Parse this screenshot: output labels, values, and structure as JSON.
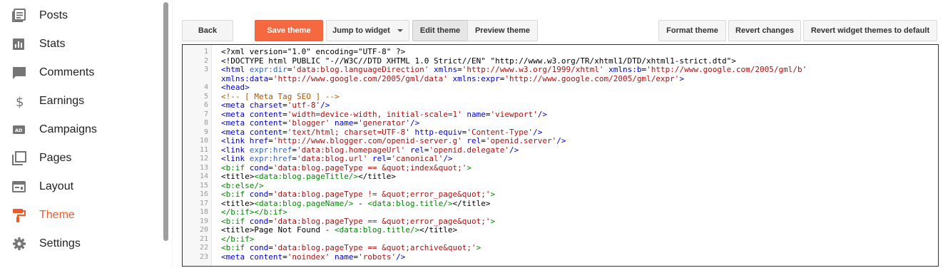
{
  "sidebar": {
    "items": [
      {
        "label": "Posts",
        "icon": "posts-icon"
      },
      {
        "label": "Stats",
        "icon": "stats-icon"
      },
      {
        "label": "Comments",
        "icon": "comments-icon"
      },
      {
        "label": "Earnings",
        "icon": "dollar-icon"
      },
      {
        "label": "Campaigns",
        "icon": "ad-icon"
      },
      {
        "label": "Pages",
        "icon": "pages-icon"
      },
      {
        "label": "Layout",
        "icon": "layout-icon"
      },
      {
        "label": "Theme",
        "icon": "paint-roller-icon",
        "active": true
      },
      {
        "label": "Settings",
        "icon": "gear-icon"
      }
    ],
    "accent": "#f05a28"
  },
  "toolbar": {
    "back": "Back",
    "save_theme": "Save theme",
    "jump_to_widget": "Jump to widget",
    "edit_theme": "Edit theme",
    "preview_theme": "Preview theme",
    "format_theme": "Format theme",
    "revert_changes": "Revert changes",
    "revert_widget_themes": "Revert widget themes to default"
  },
  "editor": {
    "lines": [
      {
        "n": "1",
        "segs": [
          [
            "p",
            "<?xml version=\"1.0\" encoding=\"UTF-8\" ?>"
          ]
        ]
      },
      {
        "n": "2",
        "segs": [
          [
            "p",
            "<!DOCTYPE html PUBLIC \"-//W3C//DTD XHTML 1.0 Strict//EN\" \"http://www.w3.org/TR/xhtml1/DTD/xhtml1-strict.dtd\">"
          ]
        ]
      },
      {
        "n": "3",
        "segs": [
          [
            "t",
            "<html "
          ],
          [
            "n",
            "expr:dir"
          ],
          [
            "p",
            "="
          ],
          [
            "s",
            "'data:blog.languageDirection'"
          ],
          [
            "p",
            " "
          ],
          [
            "a",
            "xmlns"
          ],
          [
            "p",
            "="
          ],
          [
            "s",
            "'http://www.w3.org/1999/xhtml'"
          ],
          [
            "p",
            " "
          ],
          [
            "a",
            "xmlns:b"
          ],
          [
            "p",
            "="
          ],
          [
            "s",
            "'http://www.google.com/2005/gml/b'"
          ]
        ]
      },
      {
        "n": "",
        "segs": [
          [
            "a",
            "xmlns:data"
          ],
          [
            "p",
            "="
          ],
          [
            "s",
            "'http://www.google.com/2005/gml/data'"
          ],
          [
            "p",
            " "
          ],
          [
            "a",
            "xmlns:expr"
          ],
          [
            "p",
            "="
          ],
          [
            "s",
            "'http://www.google.com/2005/gml/expr'"
          ],
          [
            "t",
            ">"
          ]
        ]
      },
      {
        "n": "4",
        "segs": [
          [
            "t",
            "<head>"
          ]
        ]
      },
      {
        "n": "5",
        "segs": [
          [
            "c",
            "<!-- [ Meta Tag SEO ] -->"
          ]
        ]
      },
      {
        "n": "6",
        "segs": [
          [
            "t",
            "<meta "
          ],
          [
            "a",
            "charset"
          ],
          [
            "p",
            "="
          ],
          [
            "s",
            "'utf-8'"
          ],
          [
            "t",
            "/>"
          ]
        ]
      },
      {
        "n": "7",
        "segs": [
          [
            "t",
            "<meta "
          ],
          [
            "a",
            "content"
          ],
          [
            "p",
            "="
          ],
          [
            "s",
            "'width=device-width, initial-scale=1'"
          ],
          [
            "p",
            " "
          ],
          [
            "a",
            "name"
          ],
          [
            "p",
            "="
          ],
          [
            "s",
            "'viewport'"
          ],
          [
            "t",
            "/>"
          ]
        ]
      },
      {
        "n": "8",
        "segs": [
          [
            "t",
            "<meta "
          ],
          [
            "a",
            "content"
          ],
          [
            "p",
            "="
          ],
          [
            "s",
            "'blogger'"
          ],
          [
            "p",
            " "
          ],
          [
            "a",
            "name"
          ],
          [
            "p",
            "="
          ],
          [
            "s",
            "'generator'"
          ],
          [
            "t",
            "/>"
          ]
        ]
      },
      {
        "n": "9",
        "segs": [
          [
            "t",
            "<meta "
          ],
          [
            "a",
            "content"
          ],
          [
            "p",
            "="
          ],
          [
            "s",
            "'text/html; charset=UTF-8'"
          ],
          [
            "p",
            " "
          ],
          [
            "a",
            "http-equiv"
          ],
          [
            "p",
            "="
          ],
          [
            "s",
            "'Content-Type'"
          ],
          [
            "t",
            "/>"
          ]
        ]
      },
      {
        "n": "10",
        "segs": [
          [
            "t",
            "<link "
          ],
          [
            "a",
            "href"
          ],
          [
            "p",
            "="
          ],
          [
            "s",
            "'http://www.blogger.com/openid-server.g'"
          ],
          [
            "p",
            " "
          ],
          [
            "a",
            "rel"
          ],
          [
            "p",
            "="
          ],
          [
            "s",
            "'openid.server'"
          ],
          [
            "t",
            "/>"
          ]
        ]
      },
      {
        "n": "11",
        "segs": [
          [
            "t",
            "<link "
          ],
          [
            "n",
            "expr:href"
          ],
          [
            "p",
            "="
          ],
          [
            "s",
            "'data:blog.homepageUrl'"
          ],
          [
            "p",
            " "
          ],
          [
            "a",
            "rel"
          ],
          [
            "p",
            "="
          ],
          [
            "s",
            "'openid.delegate'"
          ],
          [
            "t",
            "/>"
          ]
        ]
      },
      {
        "n": "12",
        "segs": [
          [
            "t",
            "<link "
          ],
          [
            "n",
            "expr:href"
          ],
          [
            "p",
            "="
          ],
          [
            "s",
            "'data:blog.url'"
          ],
          [
            "p",
            " "
          ],
          [
            "a",
            "rel"
          ],
          [
            "p",
            "="
          ],
          [
            "s",
            "'canonical'"
          ],
          [
            "t",
            "/>"
          ]
        ]
      },
      {
        "n": "13",
        "segs": [
          [
            "b",
            "<b:if "
          ],
          [
            "a",
            "cond"
          ],
          [
            "p",
            "="
          ],
          [
            "s",
            "'data:blog.pageType == &quot;index&quot;'"
          ],
          [
            "b",
            ">"
          ]
        ]
      },
      {
        "n": "14",
        "segs": [
          [
            "p",
            "<title>"
          ],
          [
            "b",
            "<data:blog.pageTitle/>"
          ],
          [
            "p",
            "</title>"
          ]
        ]
      },
      {
        "n": "15",
        "segs": [
          [
            "b",
            "<b:else/>"
          ]
        ]
      },
      {
        "n": "16",
        "segs": [
          [
            "b",
            "<b:if "
          ],
          [
            "a",
            "cond"
          ],
          [
            "p",
            "="
          ],
          [
            "s",
            "'data:blog.pageType != &quot;error_page&quot;'"
          ],
          [
            "b",
            ">"
          ]
        ]
      },
      {
        "n": "17",
        "segs": [
          [
            "p",
            "<title>"
          ],
          [
            "b",
            "<data:blog.pageName/>"
          ],
          [
            "p",
            " - "
          ],
          [
            "b",
            "<data:blog.title/>"
          ],
          [
            "p",
            "</title>"
          ]
        ]
      },
      {
        "n": "18",
        "segs": [
          [
            "b",
            "</b:if></b:if>"
          ]
        ]
      },
      {
        "n": "19",
        "segs": [
          [
            "b",
            "<b:if "
          ],
          [
            "a",
            "cond"
          ],
          [
            "p",
            "="
          ],
          [
            "s",
            "'data:blog.pageType == &quot;error_page&quot;'"
          ],
          [
            "b",
            ">"
          ]
        ]
      },
      {
        "n": "20",
        "segs": [
          [
            "p",
            "<title>Page Not Found - "
          ],
          [
            "b",
            "<data:blog.title/>"
          ],
          [
            "p",
            "</title>"
          ]
        ]
      },
      {
        "n": "21",
        "segs": [
          [
            "b",
            "</b:if>"
          ]
        ]
      },
      {
        "n": "22",
        "segs": [
          [
            "b",
            "<b:if "
          ],
          [
            "a",
            "cond"
          ],
          [
            "p",
            "="
          ],
          [
            "s",
            "'data:blog.pageType == &quot;archive&quot;'"
          ],
          [
            "b",
            ">"
          ]
        ]
      },
      {
        "n": "23",
        "segs": [
          [
            "t",
            "<meta "
          ],
          [
            "a",
            "content"
          ],
          [
            "p",
            "="
          ],
          [
            "s",
            "'noindex'"
          ],
          [
            "p",
            " "
          ],
          [
            "a",
            "name"
          ],
          [
            "p",
            "="
          ],
          [
            "s",
            "'robots'"
          ],
          [
            "t",
            "/>"
          ]
        ]
      }
    ]
  }
}
